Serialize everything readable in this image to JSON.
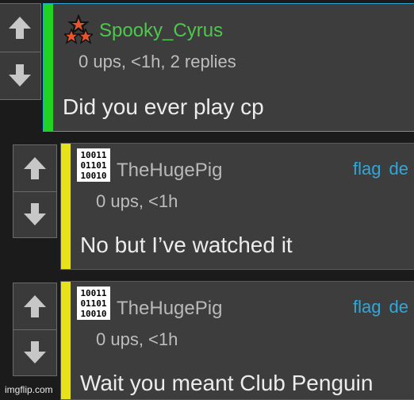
{
  "colors": {
    "accent_green": "#21d321",
    "accent_yellow": "#e7e21a",
    "username_green": "#4cc94b",
    "username_gray": "#b9b9b9",
    "link_blue": "#2fa7db"
  },
  "comments": [
    {
      "username": "Spooky_Cyrus",
      "meta": "0 ups, <1h, 2 replies",
      "text": "Did you ever play cp",
      "avatar_icon": "stars-icon"
    },
    {
      "username": "TheHugePig",
      "meta": "0 ups, <1h",
      "text": "No but I’ve watched it",
      "flag_label": "flag",
      "delete_label": "de",
      "avatar_icon": "binary-icon"
    },
    {
      "username": "TheHugePig",
      "meta": "0 ups, <1h",
      "text": "Wait you meant Club Penguin",
      "flag_label": "flag",
      "delete_label": "de",
      "avatar_icon": "binary-icon"
    }
  ],
  "watermark": "imgflip.com"
}
